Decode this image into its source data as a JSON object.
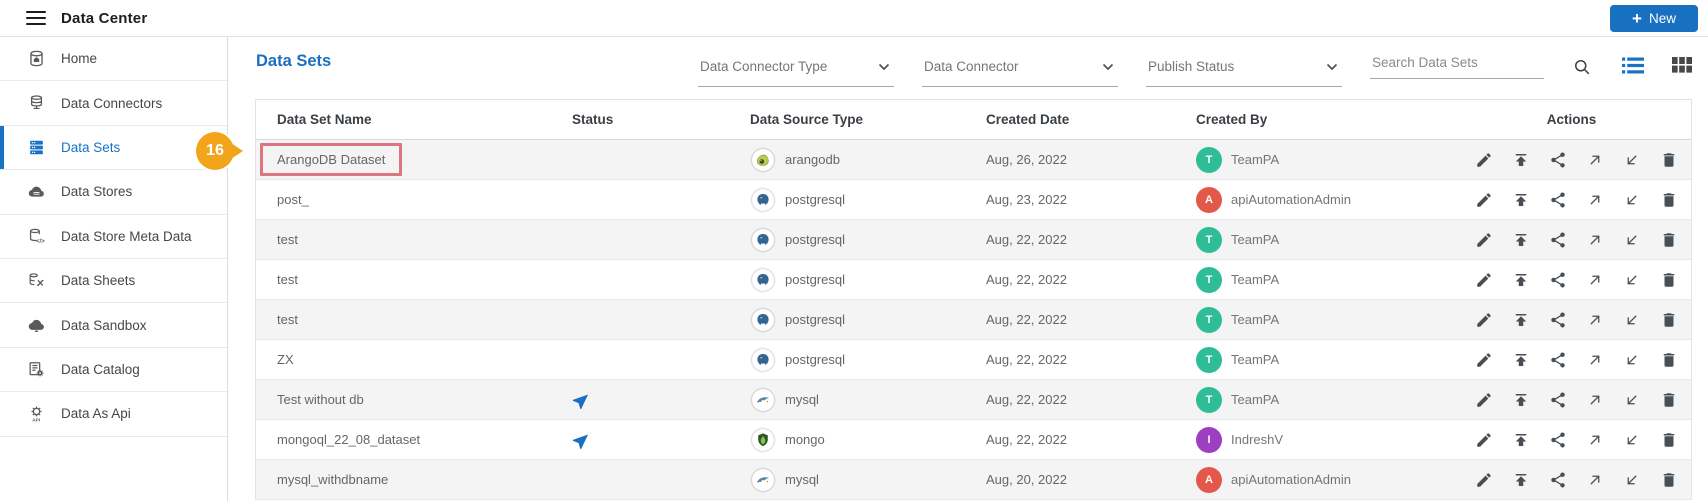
{
  "header": {
    "title": "Data Center",
    "new_button_plus": "+",
    "new_button_label": "New"
  },
  "sidebar": {
    "items": [
      {
        "label": "Home",
        "icon": "home-database-icon",
        "active": false
      },
      {
        "label": "Data Connectors",
        "icon": "database-stack-icon",
        "active": false
      },
      {
        "label": "Data Sets",
        "icon": "server-stack-icon",
        "active": true
      },
      {
        "label": "Data Stores",
        "icon": "cloud-database-icon",
        "active": false
      },
      {
        "label": "Data Store Meta Data",
        "icon": "database-code-icon",
        "active": false
      },
      {
        "label": "Data Sheets",
        "icon": "database-sync-icon",
        "active": false
      },
      {
        "label": "Data Sandbox",
        "icon": "cloud-icon",
        "active": false
      },
      {
        "label": "Data Catalog",
        "icon": "document-gear-icon",
        "active": false
      },
      {
        "label": "Data As Api",
        "icon": "gear-api-icon",
        "active": false
      }
    ]
  },
  "main": {
    "title": "Data Sets",
    "filters": [
      {
        "label": "Data Connector Type",
        "icon": "chevron-down-icon"
      },
      {
        "label": "Data Connector",
        "icon": "chevron-down-icon"
      },
      {
        "label": "Publish Status",
        "icon": "chevron-down-icon"
      }
    ],
    "search": {
      "placeholder": "Search Data Sets",
      "icon": "search-icon"
    },
    "view_toggle": {
      "list_icon": "list-view-icon",
      "grid_icon": "grid-view-icon",
      "active_view": "list"
    },
    "table": {
      "columns": [
        "Data Set Name",
        "Status",
        "Data Source Type",
        "Created Date",
        "Created By",
        "Actions"
      ],
      "action_icons": [
        "edit-icon",
        "publish-icon",
        "share-icon",
        "open-icon",
        "import-icon",
        "delete-icon"
      ],
      "rows": [
        {
          "name": "ArangoDB Dataset",
          "published": false,
          "source": "arangodb",
          "date": "Aug, 26, 2022",
          "creator": "TeamPA",
          "initial": "T",
          "avatar_color": "#2EBD96",
          "highlighted": true
        },
        {
          "name": "post_",
          "published": false,
          "source": "postgresql",
          "date": "Aug, 23, 2022",
          "creator": "apiAutomationAdmin",
          "initial": "A",
          "avatar_color": "#E4584B",
          "highlighted": false
        },
        {
          "name": "test",
          "published": false,
          "source": "postgresql",
          "date": "Aug, 22, 2022",
          "creator": "TeamPA",
          "initial": "T",
          "avatar_color": "#2EBD96",
          "highlighted": false
        },
        {
          "name": "test",
          "published": false,
          "source": "postgresql",
          "date": "Aug, 22, 2022",
          "creator": "TeamPA",
          "initial": "T",
          "avatar_color": "#2EBD96",
          "highlighted": false
        },
        {
          "name": "test",
          "published": false,
          "source": "postgresql",
          "date": "Aug, 22, 2022",
          "creator": "TeamPA",
          "initial": "T",
          "avatar_color": "#2EBD96",
          "highlighted": false
        },
        {
          "name": "ZX",
          "published": false,
          "source": "postgresql",
          "date": "Aug, 22, 2022",
          "creator": "TeamPA",
          "initial": "T",
          "avatar_color": "#2EBD96",
          "highlighted": false
        },
        {
          "name": "Test without db",
          "published": true,
          "source": "mysql",
          "date": "Aug, 22, 2022",
          "creator": "TeamPA",
          "initial": "T",
          "avatar_color": "#2EBD96",
          "highlighted": false
        },
        {
          "name": "mongoql_22_08_dataset",
          "published": true,
          "source": "mongo",
          "date": "Aug, 22, 2022",
          "creator": "IndreshV",
          "initial": "I",
          "avatar_color": "#9C3FC0",
          "highlighted": false
        },
        {
          "name": "mysql_withdbname",
          "published": false,
          "source": "mysql",
          "date": "Aug, 20, 2022",
          "creator": "apiAutomationAdmin",
          "initial": "A",
          "avatar_color": "#E4584B",
          "highlighted": false
        }
      ]
    }
  },
  "annotation": {
    "step": "16",
    "badge_color": "#F2A41B",
    "highlight_border": "#DB7580"
  },
  "colors": {
    "accent": "#1873C6",
    "row_alt": "#F4F4F4",
    "avatar_teal": "#2EBD96",
    "avatar_red": "#E4584B",
    "avatar_purple": "#9C3FC0"
  }
}
